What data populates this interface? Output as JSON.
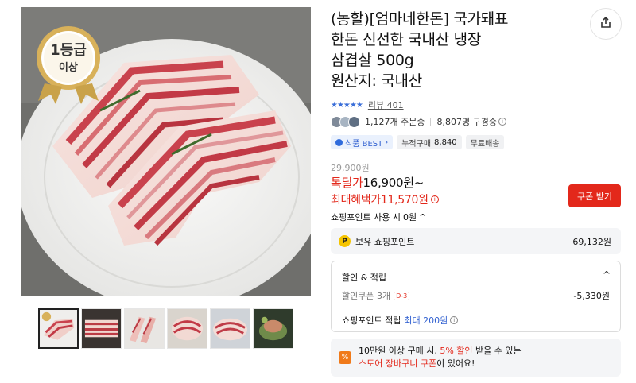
{
  "gallery": {
    "grade_badge": {
      "top": "1등급",
      "bottom": "이상"
    },
    "thumb_count": 6
  },
  "product": {
    "title_lines": [
      "(농할)[엄마네한돈] 국가돼표",
      "한돈 신선한 국내산 냉장",
      "삼겹살 500g",
      "원산지: 국내산"
    ]
  },
  "rating": {
    "stars": "★★★★★",
    "review_label": "리뷰",
    "review_count": "401"
  },
  "stats": {
    "orders": "1,127개 주문중",
    "subscribers": "8,807명 구경중"
  },
  "badges": {
    "best": "식품 BEST",
    "best_chevron": "›",
    "cumulative_label": "누적구매",
    "cumulative_value": "8,840",
    "shipping": "무료배송"
  },
  "price": {
    "original": "29,900원",
    "deal_label": "톡딜가",
    "deal_value": "16,900원~",
    "max_label": "최대혜택가",
    "max_value": "11,570원",
    "coupon_button": "쿠폰 받기",
    "points_toggle": "쇼핑포인트 사용 시",
    "points_toggle_value": "0원",
    "points_toggle_chevron": "^"
  },
  "points": {
    "icon": "P",
    "label": "보유 쇼핑포인트",
    "amount": "69,132원"
  },
  "discount": {
    "heading": "할인 & 적립",
    "chevron": "^",
    "coupon_label": "할인쿠폰 3개",
    "coupon_tag": "D-3",
    "coupon_amount": "-5,330원",
    "points_label": "쇼핑포인트 적립",
    "points_value": "최대 200원"
  },
  "promo": {
    "icon": "%",
    "line1_pre": "10만원 이상 구매 시, ",
    "line1_red": "5% 할인",
    "line1_post": " 받을 수 있는",
    "line2_red": "스토어 장바구니 쿠폰",
    "line2_post": "이 있어요!"
  },
  "colors": {
    "accent_red": "#e3281b",
    "accent_blue": "#2f5fd0",
    "point_yellow": "#f5c400",
    "promo_orange": "#f07a1a"
  }
}
